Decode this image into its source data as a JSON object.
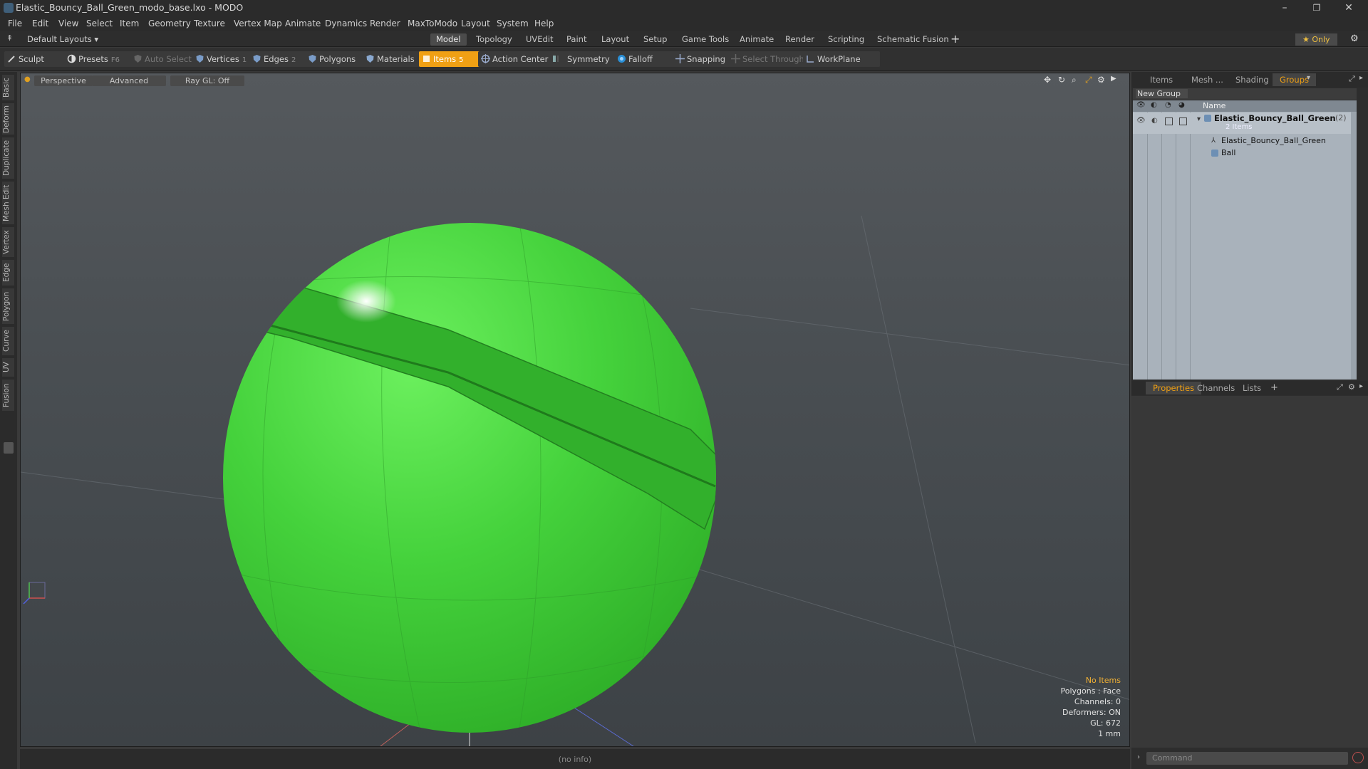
{
  "window": {
    "title": "Elastic_Bouncy_Ball_Green_modo_base.lxo - MODO",
    "minimize": "–",
    "restore": "❐",
    "close": "✕"
  },
  "menu": [
    "File",
    "Edit",
    "View",
    "Select",
    "Item",
    "Geometry",
    "Texture",
    "Vertex Map",
    "Animate",
    "Dynamics",
    "Render",
    "MaxToModo",
    "Layout",
    "System",
    "Help"
  ],
  "layoutbar": {
    "layouts_label": "Default Layouts ▾",
    "tabs": [
      "Model",
      "Topology",
      "UVEdit",
      "Paint",
      "Layout",
      "Setup",
      "Game Tools",
      "Animate",
      "Render",
      "Scripting",
      "Schematic Fusion"
    ],
    "active_tab": "Model",
    "add": "+",
    "only_label": "★  Only"
  },
  "toolbar": {
    "sculpt": "Sculpt",
    "presets": "Presets",
    "presets_key": "F6",
    "auto_select": "Auto Select",
    "vertices": "Vertices",
    "vertices_key": "1",
    "edges": "Edges",
    "edges_key": "2",
    "polygons": "Polygons",
    "materials": "Materials",
    "items": "Items",
    "items_key": "5",
    "action_center": "Action Center",
    "symmetry": "Symmetry",
    "falloff": "Falloff",
    "snapping": "Snapping",
    "select_through": "Select Through",
    "workplane": "WorkPlane"
  },
  "left_tabs": [
    "Basic",
    "Deform",
    "Duplicate",
    "Mesh Edit",
    "Vertex",
    "Edge",
    "Polygon",
    "Curve",
    "UV",
    "Fusion"
  ],
  "viewport": {
    "perspective": "Perspective",
    "advanced": "Advanced",
    "raygl": "Ray GL: Off",
    "ball_color": "#3fd13a",
    "hud": {
      "no_items": "No Items",
      "polygons": "Polygons : Face",
      "channels": "Channels: 0",
      "deformers": "Deformers: ON",
      "gl": "GL: 672",
      "unit": "1 mm"
    }
  },
  "status": {
    "info": "(no info)"
  },
  "right_panel": {
    "tabs": [
      "Items",
      "Mesh ...",
      "Shading",
      "Groups"
    ],
    "active_tab": "Groups",
    "new_group": "New Group",
    "name_header": "Name",
    "group_name": "Elastic_Bouncy_Ball_Green",
    "group_count": "(2)",
    "group_items": "2 Items",
    "children": [
      "Elastic_Bouncy_Ball_Green",
      "Ball"
    ],
    "bottom_tabs": [
      "Properties",
      "Channels",
      "Lists"
    ],
    "bottom_active": "Properties",
    "bottom_add": "+",
    "command_placeholder": "Command"
  }
}
